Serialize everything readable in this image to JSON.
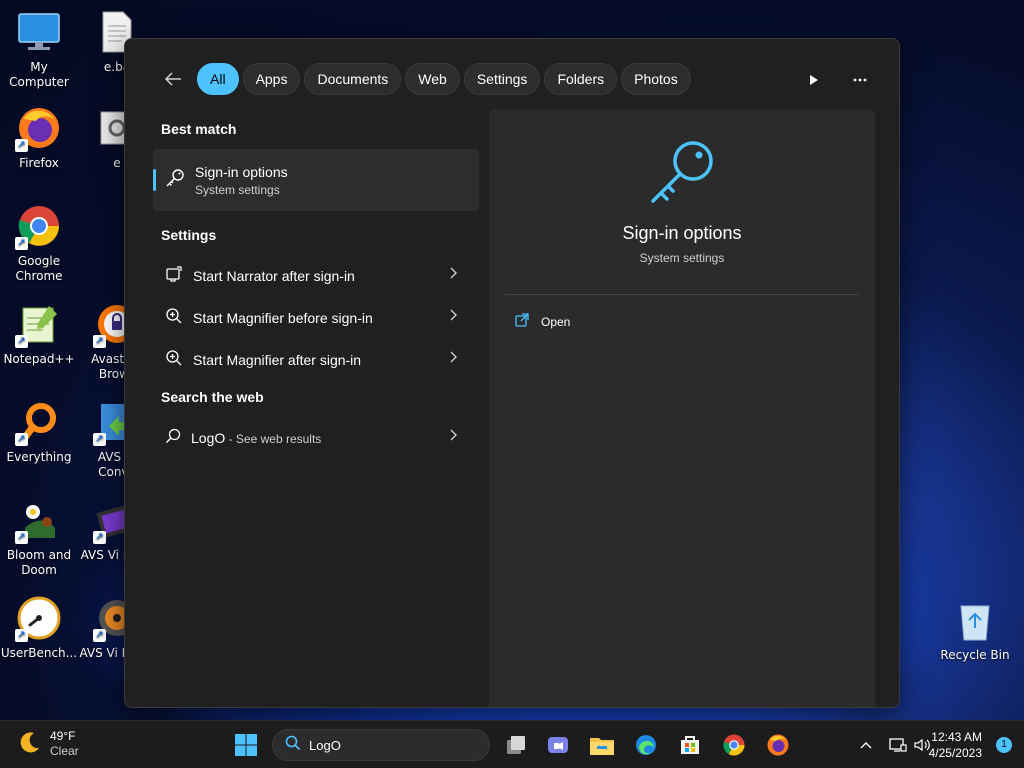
{
  "desktop": {
    "icons": [
      {
        "label": "My Computer",
        "icon": "monitor-icon"
      },
      {
        "label": "e.ba",
        "icon": "document-icon"
      },
      {
        "label": "Firefox",
        "icon": "firefox-icon"
      },
      {
        "label": "e",
        "icon": "settings-file-icon"
      },
      {
        "label": "Google Chrome",
        "icon": "chrome-icon"
      },
      {
        "label": "Notepad++",
        "icon": "notepad-plus-icon"
      },
      {
        "label": "Avast Se Brows",
        "icon": "avast-browser-icon"
      },
      {
        "label": "Everything",
        "icon": "everything-search-icon"
      },
      {
        "label": "AVS Vi Conve",
        "icon": "avs-converter-icon"
      },
      {
        "label": "Bloom and Doom",
        "icon": "bloom-doom-icon"
      },
      {
        "label": "AVS Vi Edito",
        "icon": "avs-editor-icon"
      },
      {
        "label": "UserBench...",
        "icon": "userbenchmark-icon"
      },
      {
        "label": "AVS Vi ReMa",
        "icon": "avs-remaker-icon"
      },
      {
        "label": "Recycle Bin",
        "icon": "recycle-bin-icon"
      }
    ]
  },
  "search_flyout": {
    "filters": [
      {
        "label": "All",
        "active": true
      },
      {
        "label": "Apps",
        "active": false
      },
      {
        "label": "Documents",
        "active": false
      },
      {
        "label": "Web",
        "active": false
      },
      {
        "label": "Settings",
        "active": false
      },
      {
        "label": "Folders",
        "active": false
      },
      {
        "label": "Photos",
        "active": false
      }
    ],
    "best_match": {
      "section_title": "Best match",
      "title": "Sign-in options",
      "subtitle": "System settings",
      "icon": "key-icon"
    },
    "settings": {
      "section_title": "Settings",
      "items": [
        {
          "label": "Start Narrator after sign-in",
          "icon": "narrator-icon"
        },
        {
          "label": "Start Magnifier before sign-in",
          "icon": "magnifier-icon"
        },
        {
          "label": "Start Magnifier after sign-in",
          "icon": "magnifier-icon"
        }
      ]
    },
    "web": {
      "section_title": "Search the web",
      "query": "LogO",
      "suffix": " - See web results"
    },
    "preview": {
      "title": "Sign-in options",
      "subtitle": "System settings",
      "action_open": "Open"
    }
  },
  "taskbar": {
    "weather": {
      "temp": "49°F",
      "condition": "Clear"
    },
    "search_value": "LogO",
    "clock": {
      "time": "12:43 AM",
      "date": "4/25/2023"
    },
    "notification_count": "1"
  },
  "colors": {
    "accent": "#4cc2ff",
    "flyout_bg": "#202020",
    "pane_bg": "#2b2b2b"
  }
}
